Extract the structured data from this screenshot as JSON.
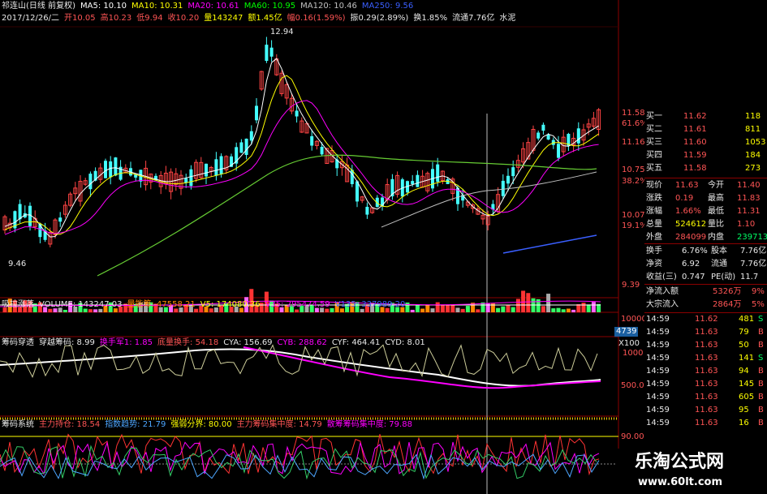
{
  "header": {
    "line1": [
      {
        "text": "祁连山(日线 前复权)",
        "color": "#e8e8e8"
      },
      {
        "text": "MA5: 10.10",
        "color": "#ffffff"
      },
      {
        "text": "MA10: 10.31",
        "color": "#ffff00"
      },
      {
        "text": "MA20: 10.61",
        "color": "#ff00ff"
      },
      {
        "text": "MA60: 10.95",
        "color": "#00ff00"
      },
      {
        "text": "MA120: 10.46",
        "color": "#c0c0c0"
      },
      {
        "text": "MA250: 9.56",
        "color": "#3a5fff"
      }
    ],
    "line2": [
      {
        "text": "2017/12/26/二",
        "color": "#e8e8e8"
      },
      {
        "text": "开10.05",
        "color": "#ff5555"
      },
      {
        "text": "高10.23",
        "color": "#ff5555"
      },
      {
        "text": "低9.94",
        "color": "#ff5555"
      },
      {
        "text": "收10.20",
        "color": "#ff5555"
      },
      {
        "text": "量143247",
        "color": "#ffff00"
      },
      {
        "text": "额1.45亿",
        "color": "#ffff00"
      },
      {
        "text": "幅0.16(1.59%)",
        "color": "#ff5555"
      },
      {
        "text": "振0.29(2.89%)",
        "color": "#e8e8e8"
      },
      {
        "text": "换1.85%",
        "color": "#e8e8e8"
      },
      {
        "text": "流通7.76亿",
        "color": "#e8e8e8"
      },
      {
        "text": "水泥",
        "color": "#e8e8e8"
      }
    ]
  },
  "price_chart": {
    "high_label": "12.94",
    "low_label": "9.46",
    "axis_labels": [
      {
        "value": "11.58",
        "color": "#ff5555"
      },
      {
        "value": "61.6%",
        "color": "#ff5555"
      },
      {
        "value": "11.16",
        "color": "#ff5555"
      },
      {
        "value": "10.75",
        "color": "#ff5555"
      },
      {
        "value": "38.2%",
        "color": "#ff5555"
      },
      {
        "value": "10.07",
        "color": "#ff5555"
      },
      {
        "value": "19.1%",
        "color": "#ff5555"
      },
      {
        "value": "9.39",
        "color": "#ff5555"
      }
    ]
  },
  "volume_panel": {
    "title": "吸拉涨落",
    "items": [
      {
        "text": "VOLUME: 143247.03",
        "color": "#e8e8e8"
      },
      {
        "text": "量能筹: 47558.21",
        "color": "#ff8800"
      },
      {
        "text": "V5: 174080.36",
        "color": "#ffff00"
      },
      {
        "text": "V35: 295474.59",
        "color": "#ff00ff"
      },
      {
        "text": "V135: 337989.20",
        "color": "#3a5fff"
      }
    ],
    "axis_top": "10000",
    "axis_current": "4739",
    "axis_unit": "X100"
  },
  "chip_panel": {
    "title": "筹码穿透",
    "items": [
      {
        "text": "穿越筹码: 8.99",
        "color": "#e8e8e8"
      },
      {
        "text": "换手军1: 1.85",
        "color": "#ff00ff"
      },
      {
        "text": "底量换手: 54.18",
        "color": "#ff5555"
      },
      {
        "text": "CYA: 156.69",
        "color": "#e8e8e8"
      },
      {
        "text": "CYB: 288.62",
        "color": "#ff00ff"
      },
      {
        "text": "CYF: 464.41",
        "color": "#e8e8e8"
      },
      {
        "text": "CYD: 8.01",
        "color": "#e8e8e8"
      }
    ],
    "axis_top": "1000",
    "axis_mid": "500.0"
  },
  "system_panel": {
    "title": "筹码系统",
    "items": [
      {
        "text": "主力持仓: 18.54",
        "color": "#ff5555"
      },
      {
        "text": "指数趋势: 21.79",
        "color": "#4da6ff"
      },
      {
        "text": "强弱分界: 80.00",
        "color": "#ffff00"
      },
      {
        "text": "主力筹码集中度: 14.79",
        "color": "#ff5555"
      },
      {
        "text": "散筹筹码集中度: 79.88",
        "color": "#ff00ff"
      }
    ],
    "axis_top": "90.00"
  },
  "quote_panel": {
    "bids": [
      {
        "label": "买一",
        "price": "11.62",
        "vol": "118"
      },
      {
        "label": "买二",
        "price": "11.61",
        "vol": "811"
      },
      {
        "label": "买三",
        "price": "11.60",
        "vol": "1053"
      },
      {
        "label": "买四",
        "price": "11.59",
        "vol": "184"
      },
      {
        "label": "买五",
        "price": "11.58",
        "vol": "273"
      }
    ],
    "stats": [
      {
        "l1": "现价",
        "v1": "11.63",
        "v1c": "#ff5555",
        "l2": "今开",
        "v2": "11.40",
        "v2c": "#ff5555"
      },
      {
        "l1": "涨跌",
        "v1": "0.19",
        "v1c": "#ff5555",
        "l2": "最高",
        "v2": "11.83",
        "v2c": "#ff5555"
      },
      {
        "l1": "涨幅",
        "v1": "1.66%",
        "v1c": "#ff5555",
        "l2": "最低",
        "v2": "11.31",
        "v2c": "#ff5555"
      },
      {
        "l1": "总量",
        "v1": "524612",
        "v1c": "#ffff00",
        "l2": "量比",
        "v2": "1.10",
        "v2c": "#ff5555"
      },
      {
        "l1": "外盘",
        "v1": "284099",
        "v1c": "#ff5555",
        "l2": "内盘",
        "v2": "239713",
        "v2c": "#00ff66"
      }
    ],
    "stats2": [
      {
        "l1": "换手",
        "v1": "6.76%",
        "v1c": "#e8e8e8",
        "l2": "股本",
        "v2": "7.76亿",
        "v2c": "#e8e8e8"
      },
      {
        "l1": "净资",
        "v1": "6.92",
        "v1c": "#e8e8e8",
        "l2": "流通",
        "v2": "7.76亿",
        "v2c": "#e8e8e8"
      },
      {
        "l1": "收益(三)",
        "v1": "0.747",
        "v1c": "#e8e8e8",
        "l2": "PE(动)",
        "v2": "11.7",
        "v2c": "#e8e8e8"
      }
    ],
    "flows": [
      {
        "label": "净流入额",
        "value": "5326万",
        "pct": "9%"
      },
      {
        "label": "大宗流入",
        "value": "2864万",
        "pct": "5%"
      }
    ],
    "ticks": [
      {
        "time": "14:59",
        "price": "11.62",
        "vol": "481",
        "side": "S"
      },
      {
        "time": "14:59",
        "price": "11.63",
        "vol": "79",
        "side": "B"
      },
      {
        "time": "14:59",
        "price": "11.63",
        "vol": "50",
        "side": "B"
      },
      {
        "time": "14:59",
        "price": "11.63",
        "vol": "141",
        "side": "S"
      },
      {
        "time": "14:59",
        "price": "11.63",
        "vol": "94",
        "side": "B"
      },
      {
        "time": "14:59",
        "price": "11.63",
        "vol": "145",
        "side": "B"
      },
      {
        "time": "14:59",
        "price": "11.63",
        "vol": "605",
        "side": "B"
      },
      {
        "time": "14:59",
        "price": "11.63",
        "vol": "95",
        "side": "B"
      },
      {
        "time": "14:59",
        "price": "11.63",
        "vol": "16",
        "side": "B"
      }
    ]
  },
  "watermark": {
    "title": "乐淘公式网",
    "url": "www.60lt.com"
  }
}
